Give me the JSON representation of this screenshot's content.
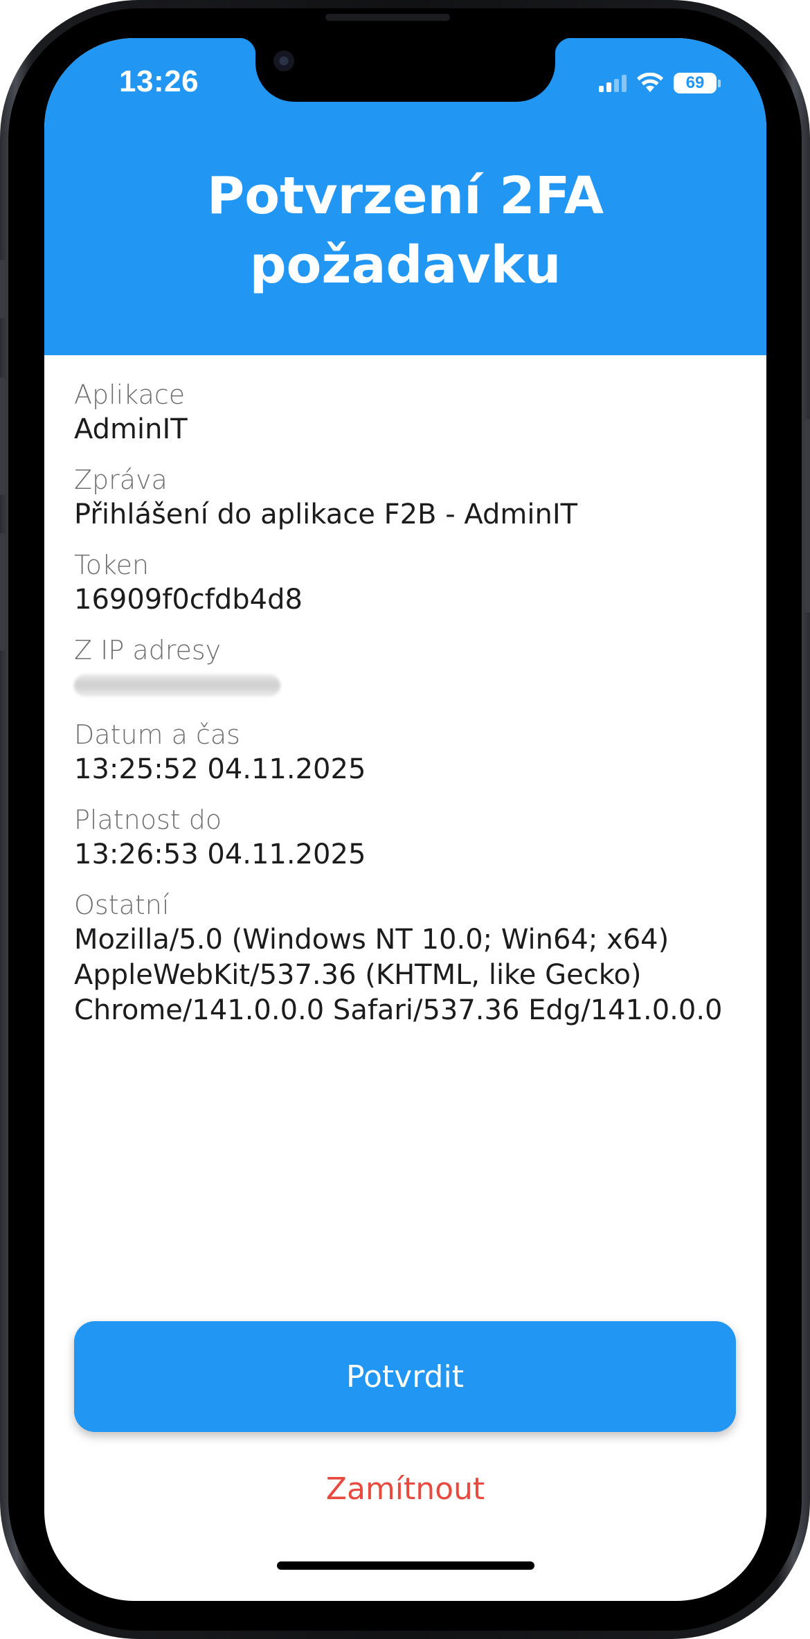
{
  "status_bar": {
    "time": "13:26",
    "battery": "69",
    "signal_icon": "cellular-signal-icon",
    "wifi_icon": "wifi-icon"
  },
  "header": {
    "title": "Potvrzení 2FA\npožadavku",
    "background_color": "#2196f3"
  },
  "details": [
    {
      "label": "Aplikace",
      "value": "AdminIT"
    },
    {
      "label": "Zpráva",
      "value": "Přihlášení do aplikace F2B - AdminIT"
    },
    {
      "label": "Token",
      "value": "16909f0cfdb4d8"
    },
    {
      "label": "Z IP adresy",
      "value": ""
    },
    {
      "label": "Datum a čas",
      "value": "13:25:52 04.11.2025"
    },
    {
      "label": "Platnost do",
      "value": "13:26:53 04.11.2025"
    },
    {
      "label": "Ostatní",
      "value": "Mozilla/5.0 (Windows NT 10.0; Win64; x64) AppleWebKit/537.36 (KHTML, like Gecko) Chrome/141.0.0.0 Safari/537.36 Edg/141.0.0.0"
    }
  ],
  "actions": {
    "confirm_label": "Potvrdit",
    "reject_label": "Zamítnout",
    "confirm_color": "#2196f3",
    "reject_color": "#e84a3f"
  }
}
